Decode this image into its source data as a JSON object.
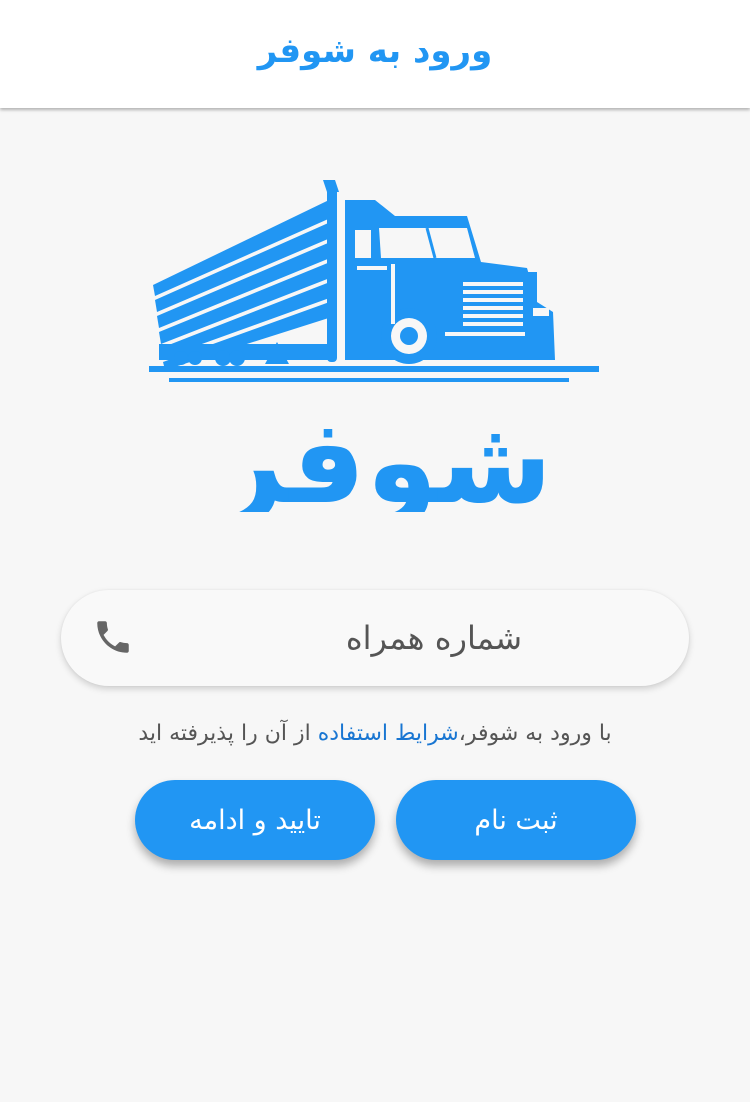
{
  "appbar": {
    "title": "ورود به شوفر"
  },
  "logo": {
    "brand_text": "شوفر",
    "accent_color": "#2196f3"
  },
  "phone": {
    "placeholder": "شماره همراه",
    "icon": "phone-icon"
  },
  "terms": {
    "prefix": "با ورود به شوفر،",
    "link_text": "شرایط استفاده",
    "suffix": " از آن را پذیرفته اید"
  },
  "buttons": {
    "register_label": "ثبت نام",
    "continue_label": "تایید و ادامه"
  },
  "colors": {
    "primary": "#2196f3",
    "link": "#1976d2",
    "background": "#f7f7f7"
  }
}
